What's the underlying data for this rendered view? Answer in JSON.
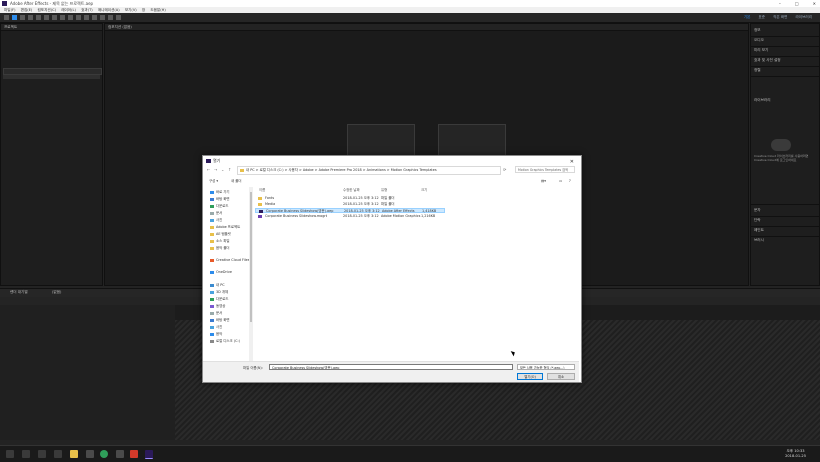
{
  "app": {
    "title": "Adobe After Effects - 제목 없는 프로젝트.aep",
    "menu": [
      "파일(F)",
      "편집(E)",
      "컴포지션(C)",
      "레이어(L)",
      "효과(T)",
      "애니메이션(A)",
      "보기(V)",
      "창",
      "도움말(H)"
    ],
    "workspaces": [
      "기본",
      "표준",
      "작은 화면",
      "라이브러리"
    ],
    "active_workspace": "기본"
  },
  "panels": {
    "project_tab": "프로젝트",
    "composition_tab": "컴포지션 (없음)",
    "timeline_tab": "(없음)",
    "render_tab": "렌더 대기열"
  },
  "right_panel": {
    "items": [
      "정보",
      "오디오",
      "미리 보기",
      "효과 및 사전 설정",
      "정렬",
      "라이브러리",
      "문자",
      "단락",
      "페인트",
      "브러시"
    ],
    "library_msg": "Creative Cloud 라이브러리를 사용하려면 Creative Cloud에 로그인하세요"
  },
  "dialog": {
    "title": "열기",
    "address": "내 PC > 로컬 디스크 (C:) > 사용자 > Adobe > Adobe Premiere Pro 2018 > Animations > Motion Graphics Templates",
    "search_placeholder": "Motion Graphics Templates 검색",
    "organize": "구성 ▾",
    "new_folder": "새 폴더",
    "nav_items": [
      "바로 가기",
      "바탕 화면",
      "다운로드",
      "문서",
      "사진",
      "Adobe 프로젝트",
      "AE 템플릿",
      "소스 파일",
      "음악 폴더",
      "Creative Cloud Files",
      "OneDrive",
      "내 PC",
      "3D 개체",
      "다운로드",
      "동영상",
      "문서",
      "바탕 화면",
      "사진",
      "음악",
      "로컬 디스크 (C:)"
    ],
    "columns": [
      "이름",
      "수정한 날짜",
      "유형",
      "크기"
    ],
    "files": [
      {
        "name": "Fonts",
        "date": "2018-01-25 오후 3:12",
        "type": "파일 폴더",
        "size": "",
        "kind": "folder"
      },
      {
        "name": "Media",
        "date": "2018-01-25 오후 3:12",
        "type": "파일 폴더",
        "size": "",
        "kind": "folder"
      },
      {
        "name": "Corporate Business Slideshow(영문).aep",
        "date": "2018-01-25 오후 3:12",
        "type": "Adobe After Effects",
        "size": "1,418KB",
        "kind": "aep",
        "selected": true
      },
      {
        "name": "Corporate Business Slideshow.mogrt",
        "date": "2018-01-25 오후 3:12",
        "type": "Adobe Motion Graphics",
        "size": "1,216KB",
        "kind": "mogrt"
      }
    ],
    "filename_label": "파일 이름(N):",
    "filename_value": "Corporate Business Slideshow(영문).aep",
    "filetype_value": "모든 사용 가능한 형식 (*.aep...)",
    "open_button": "열기(O)",
    "cancel_button": "취소"
  },
  "taskbar": {
    "time": "오후 10:33",
    "date": "2018-01-25"
  }
}
